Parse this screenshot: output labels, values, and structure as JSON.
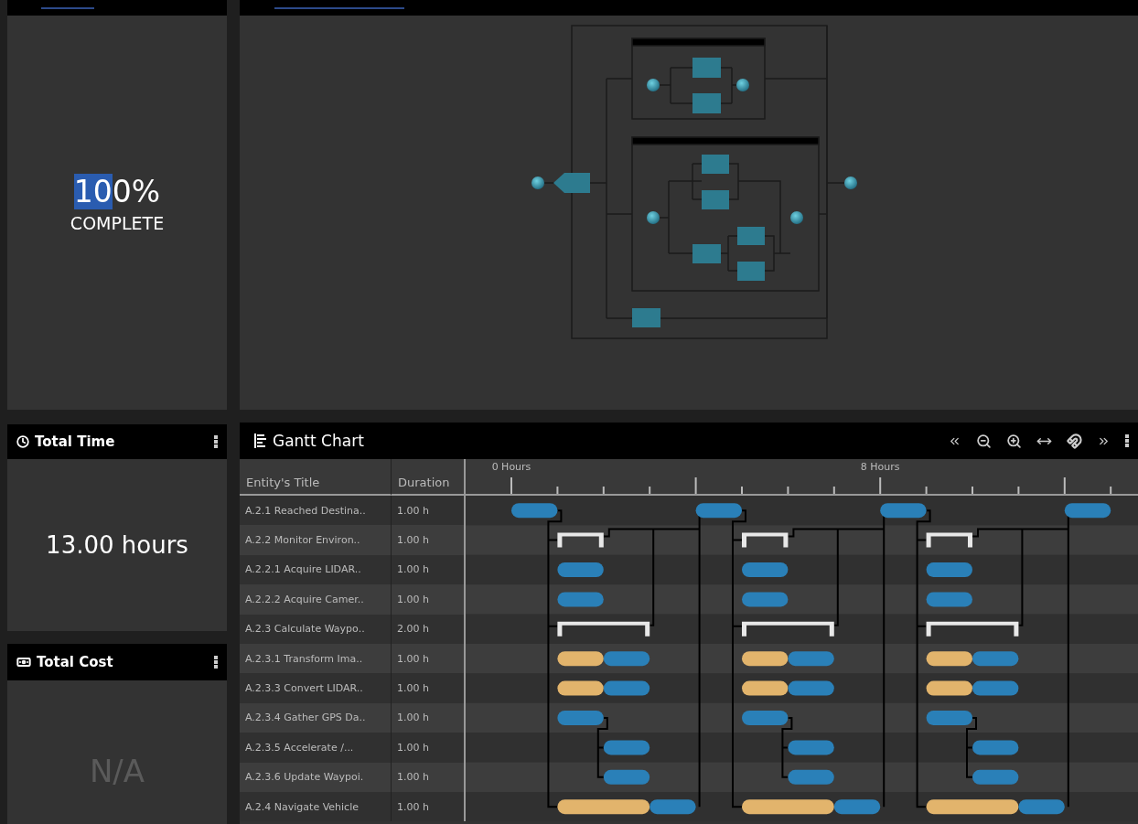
{
  "progress_panel": {
    "value_selected": "10",
    "value_rest": "0%",
    "label": "COMPLETE"
  },
  "total_time": {
    "title": "Total Time",
    "value": "13.00 hours"
  },
  "total_cost": {
    "title": "Total Cost",
    "value": "N/A"
  },
  "gantt": {
    "title": "Gantt Chart",
    "columns": [
      "Entity's Title",
      "Duration"
    ],
    "scale_labels": [
      "0 Hours",
      "8 Hours"
    ],
    "rows": [
      {
        "title": "A.2.1 Reached Destina..",
        "duration": "1.00 h",
        "timeline": [
          {
            "kind": "task"
          },
          {
            "kind": "empty"
          },
          {
            "kind": "empty"
          },
          {
            "kind": "empty"
          },
          {
            "kind": "task"
          },
          {
            "kind": "empty"
          },
          {
            "kind": "empty"
          },
          {
            "kind": "empty"
          },
          {
            "kind": "task"
          },
          {
            "kind": "empty"
          },
          {
            "kind": "empty"
          },
          {
            "kind": "empty"
          },
          {
            "kind": "task"
          }
        ]
      },
      {
        "title": "A.2.2 Monitor Environ..",
        "duration": "1.00 h",
        "timeline": [
          {
            "kind": "empty"
          },
          {
            "kind": "summary"
          },
          {
            "kind": "empty"
          },
          {
            "kind": "empty"
          },
          {
            "kind": "empty"
          },
          {
            "kind": "summary"
          },
          {
            "kind": "empty"
          },
          {
            "kind": "empty"
          },
          {
            "kind": "empty"
          },
          {
            "kind": "summary"
          }
        ]
      },
      {
        "title": "A.2.2.1 Acquire LIDAR..",
        "duration": "1.00 h",
        "timeline": [
          {
            "kind": "empty"
          },
          {
            "kind": "task"
          },
          {
            "kind": "empty"
          },
          {
            "kind": "empty"
          },
          {
            "kind": "empty"
          },
          {
            "kind": "task"
          },
          {
            "kind": "empty"
          },
          {
            "kind": "empty"
          },
          {
            "kind": "empty"
          },
          {
            "kind": "task"
          }
        ]
      },
      {
        "title": "A.2.2.2 Acquire Camer..",
        "duration": "1.00 h",
        "timeline": [
          {
            "kind": "empty"
          },
          {
            "kind": "task"
          },
          {
            "kind": "empty"
          },
          {
            "kind": "empty"
          },
          {
            "kind": "empty"
          },
          {
            "kind": "task"
          },
          {
            "kind": "empty"
          },
          {
            "kind": "empty"
          },
          {
            "kind": "empty"
          },
          {
            "kind": "task"
          }
        ]
      },
      {
        "title": "A.2.3 Calculate Waypo..",
        "duration": "2.00 h",
        "timeline": [
          {
            "kind": "empty"
          },
          {
            "kind": "summary"
          },
          {
            "kind": "summary"
          },
          {
            "kind": "empty"
          },
          {
            "kind": "empty"
          },
          {
            "kind": "summary"
          },
          {
            "kind": "summary"
          },
          {
            "kind": "empty"
          },
          {
            "kind": "empty"
          },
          {
            "kind": "summary"
          },
          {
            "kind": "summary"
          }
        ]
      },
      {
        "title": "A.2.3.1 Transform Ima..",
        "duration": "1.00 h",
        "timeline": [
          {
            "kind": "empty"
          },
          {
            "kind": "waiting"
          },
          {
            "kind": "task"
          },
          {
            "kind": "empty"
          },
          {
            "kind": "empty"
          },
          {
            "kind": "waiting"
          },
          {
            "kind": "task"
          },
          {
            "kind": "empty"
          },
          {
            "kind": "empty"
          },
          {
            "kind": "waiting"
          },
          {
            "kind": "task"
          }
        ]
      },
      {
        "title": "A.2.3.3 Convert LIDAR..",
        "duration": "1.00 h",
        "timeline": [
          {
            "kind": "empty"
          },
          {
            "kind": "waiting"
          },
          {
            "kind": "task"
          },
          {
            "kind": "empty"
          },
          {
            "kind": "empty"
          },
          {
            "kind": "waiting"
          },
          {
            "kind": "task"
          },
          {
            "kind": "empty"
          },
          {
            "kind": "empty"
          },
          {
            "kind": "waiting"
          },
          {
            "kind": "task"
          }
        ]
      },
      {
        "title": "A.2.3.4 Gather GPS Da..",
        "duration": "1.00 h",
        "timeline": [
          {
            "kind": "empty"
          },
          {
            "kind": "task"
          },
          {
            "kind": "empty"
          },
          {
            "kind": "empty"
          },
          {
            "kind": "empty"
          },
          {
            "kind": "task"
          },
          {
            "kind": "empty"
          },
          {
            "kind": "empty"
          },
          {
            "kind": "empty"
          },
          {
            "kind": "task"
          }
        ]
      },
      {
        "title": "A.2.3.5 Accelerate /...",
        "duration": "1.00 h",
        "timeline": [
          {
            "kind": "empty"
          },
          {
            "kind": "empty"
          },
          {
            "kind": "task"
          },
          {
            "kind": "empty"
          },
          {
            "kind": "empty"
          },
          {
            "kind": "empty"
          },
          {
            "kind": "task"
          },
          {
            "kind": "empty"
          },
          {
            "kind": "empty"
          },
          {
            "kind": "empty"
          },
          {
            "kind": "task"
          }
        ]
      },
      {
        "title": "A.2.3.6 Update Waypoi.",
        "duration": "1.00 h",
        "timeline": [
          {
            "kind": "empty"
          },
          {
            "kind": "empty"
          },
          {
            "kind": "task"
          },
          {
            "kind": "empty"
          },
          {
            "kind": "empty"
          },
          {
            "kind": "empty"
          },
          {
            "kind": "task"
          },
          {
            "kind": "empty"
          },
          {
            "kind": "empty"
          },
          {
            "kind": "empty"
          },
          {
            "kind": "task"
          }
        ]
      },
      {
        "title": "A.2.4 Navigate Vehicle",
        "duration": "1.00 h",
        "timeline": [
          {
            "kind": "empty"
          },
          {
            "kind": "waiting"
          },
          {
            "kind": "waiting"
          },
          {
            "kind": "task"
          },
          {
            "kind": "empty"
          },
          {
            "kind": "waiting"
          },
          {
            "kind": "waiting"
          },
          {
            "kind": "task"
          },
          {
            "kind": "empty"
          },
          {
            "kind": "waiting"
          },
          {
            "kind": "waiting"
          },
          {
            "kind": "task"
          }
        ]
      }
    ]
  }
}
